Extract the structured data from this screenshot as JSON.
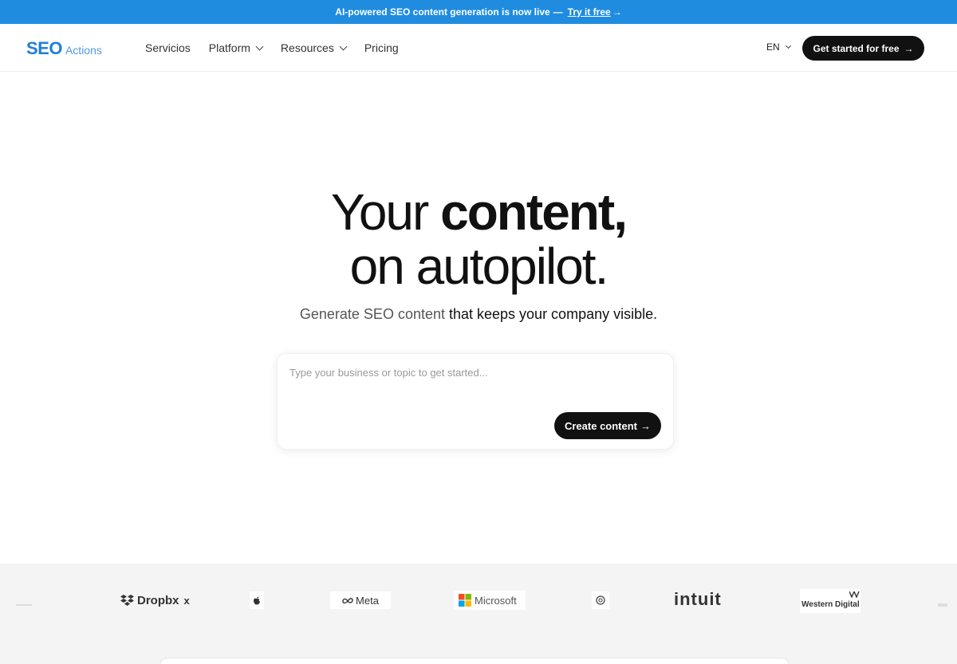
{
  "announcement": {
    "text": "AI-powered SEO content generation is now live",
    "dash": "—",
    "link": "Try it free",
    "arrow": "→"
  },
  "nav": {
    "logo_bold": "SEO",
    "logo_light": "Actions",
    "items": [
      {
        "label": "Servicios",
        "dropdown": false
      },
      {
        "label": "Platform",
        "dropdown": true
      },
      {
        "label": "Resources",
        "dropdown": true
      },
      {
        "label": "Pricing",
        "dropdown": false
      }
    ],
    "language": "EN",
    "cta": "Get started for free",
    "cta_arrow": "→"
  },
  "hero": {
    "line1_normal": "Your ",
    "line1_bold": "content,",
    "line2": "on autopilot.",
    "subtitle_muted": "Generate SEO content",
    "subtitle_dark": " that keeps your company visible."
  },
  "prompt": {
    "placeholder": "Type your business or topic to get started...",
    "value": "",
    "button": "Create content",
    "button_arrow": "→"
  },
  "logos": [
    {
      "name": "Dropbx",
      "suffix": "x"
    },
    {
      "name": "Meta"
    },
    {
      "name": "Microsoft"
    },
    {
      "name": "intuit"
    },
    {
      "name": "Western Digital"
    }
  ],
  "colors": {
    "accent": "#1f8ce0",
    "logo_blue": "#1f7fd6",
    "dark": "#111111",
    "band": "#f4f4f4"
  }
}
